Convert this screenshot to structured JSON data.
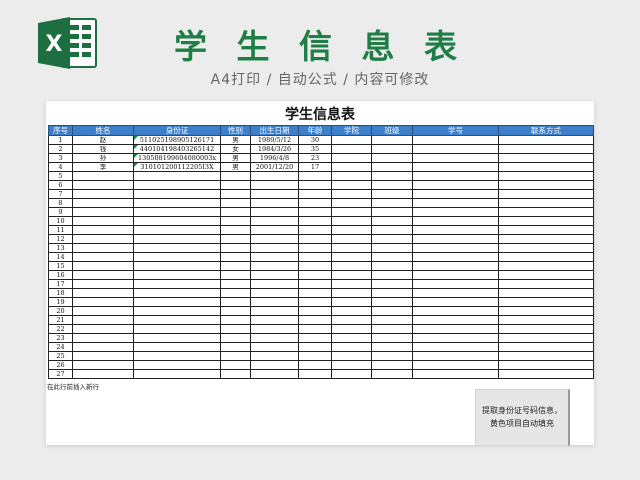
{
  "header": {
    "title": "学 生 信 息 表",
    "subtitle": "A4打印 / 自动公式 / 内容可修改",
    "logo_letter": "X"
  },
  "sheet": {
    "title": "学生信息表",
    "columns": [
      "序号",
      "姓名",
      "身份证",
      "性别",
      "出生日期",
      "年龄",
      "学院",
      "班级",
      "学号",
      "联系方式"
    ],
    "rows": [
      [
        "1",
        "赵",
        "511025198905126171",
        "男",
        "1989/5/12",
        "30",
        "",
        "",
        "",
        ""
      ],
      [
        "2",
        "钱",
        "440104198403265142",
        "女",
        "1984/3/26",
        "35",
        "",
        "",
        "",
        ""
      ],
      [
        "3",
        "孙",
        "130508199604080003x",
        "男",
        "1996/4/8",
        "23",
        "",
        "",
        "",
        ""
      ],
      [
        "4",
        "李",
        "310101200112205I3X",
        "男",
        "2001/12/20",
        "17",
        "",
        "",
        "",
        ""
      ],
      [
        "5",
        "",
        "",
        "",
        "",
        "",
        "",
        "",
        "",
        ""
      ],
      [
        "6",
        "",
        "",
        "",
        "",
        "",
        "",
        "",
        "",
        ""
      ],
      [
        "7",
        "",
        "",
        "",
        "",
        "",
        "",
        "",
        "",
        ""
      ],
      [
        "8",
        "",
        "",
        "",
        "",
        "",
        "",
        "",
        "",
        ""
      ],
      [
        "9",
        "",
        "",
        "",
        "",
        "",
        "",
        "",
        "",
        ""
      ],
      [
        "10",
        "",
        "",
        "",
        "",
        "",
        "",
        "",
        "",
        ""
      ],
      [
        "11",
        "",
        "",
        "",
        "",
        "",
        "",
        "",
        "",
        ""
      ],
      [
        "12",
        "",
        "",
        "",
        "",
        "",
        "",
        "",
        "",
        ""
      ],
      [
        "13",
        "",
        "",
        "",
        "",
        "",
        "",
        "",
        "",
        ""
      ],
      [
        "14",
        "",
        "",
        "",
        "",
        "",
        "",
        "",
        "",
        ""
      ],
      [
        "15",
        "",
        "",
        "",
        "",
        "",
        "",
        "",
        "",
        ""
      ],
      [
        "16",
        "",
        "",
        "",
        "",
        "",
        "",
        "",
        "",
        ""
      ],
      [
        "17",
        "",
        "",
        "",
        "",
        "",
        "",
        "",
        "",
        ""
      ],
      [
        "18",
        "",
        "",
        "",
        "",
        "",
        "",
        "",
        "",
        ""
      ],
      [
        "19",
        "",
        "",
        "",
        "",
        "",
        "",
        "",
        "",
        ""
      ],
      [
        "20",
        "",
        "",
        "",
        "",
        "",
        "",
        "",
        "",
        ""
      ],
      [
        "21",
        "",
        "",
        "",
        "",
        "",
        "",
        "",
        "",
        ""
      ],
      [
        "22",
        "",
        "",
        "",
        "",
        "",
        "",
        "",
        "",
        ""
      ],
      [
        "23",
        "",
        "",
        "",
        "",
        "",
        "",
        "",
        "",
        ""
      ],
      [
        "24",
        "",
        "",
        "",
        "",
        "",
        "",
        "",
        "",
        ""
      ],
      [
        "25",
        "",
        "",
        "",
        "",
        "",
        "",
        "",
        "",
        ""
      ],
      [
        "26",
        "",
        "",
        "",
        "",
        "",
        "",
        "",
        "",
        ""
      ],
      [
        "27",
        "",
        "",
        "",
        "",
        "",
        "",
        "",
        "",
        ""
      ]
    ],
    "note": "在此行前插入新行"
  },
  "tip": {
    "text": "提取身份证号码信息，黄色项目自动填充"
  },
  "colors": {
    "title_green": "#1e7e45",
    "header_blue": "#3d7fc9",
    "excel_green": "#1d6f42"
  }
}
